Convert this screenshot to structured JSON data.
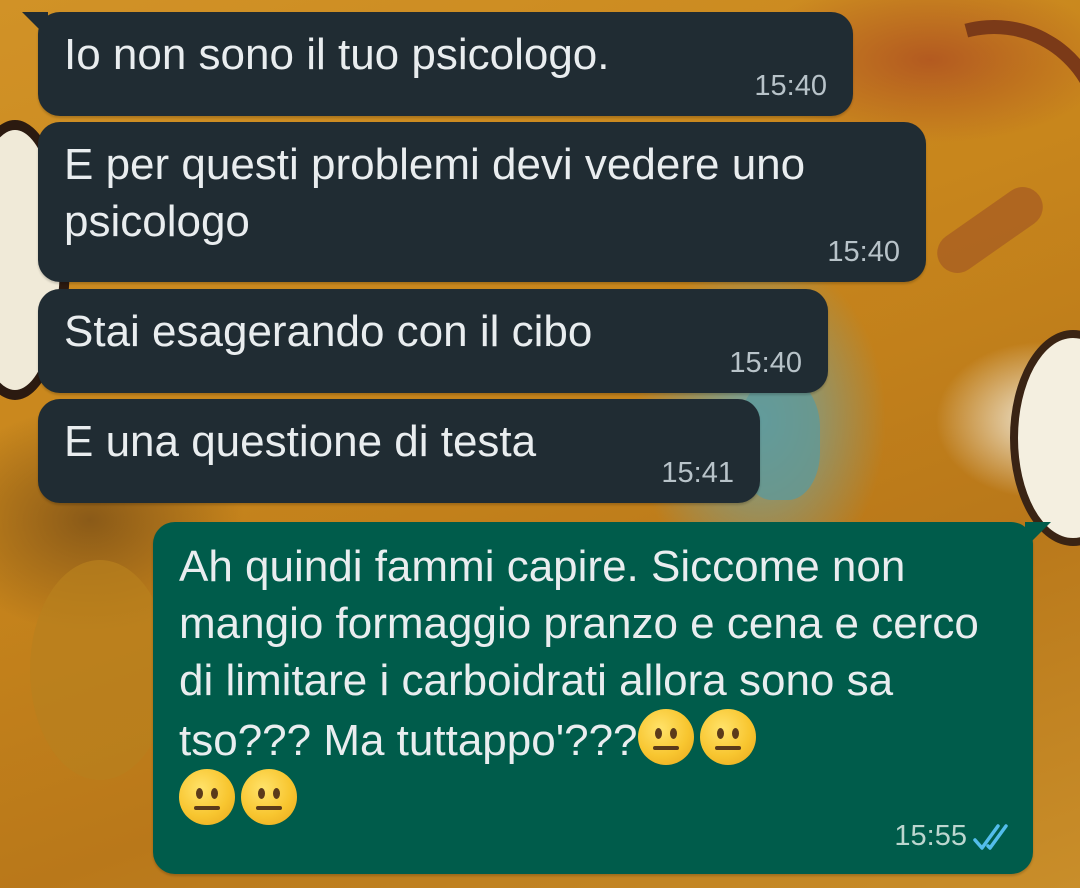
{
  "messages": [
    {
      "direction": "incoming",
      "text": "Io non sono il tuo psicologo.",
      "time": "15:40"
    },
    {
      "direction": "incoming",
      "text": "E per questi problemi devi vedere uno psicologo",
      "time": "15:40"
    },
    {
      "direction": "incoming",
      "text": "Stai esagerando con il cibo",
      "time": "15:40"
    },
    {
      "direction": "incoming",
      "text": "E una questione di testa",
      "time": "15:41"
    },
    {
      "direction": "outgoing",
      "text": "Ah quindi fammi capire. Siccome non mangio formaggio pranzo e cena e cerco di limitare i carboidrati allora sono sa tso??? Ma tuttappo'???",
      "emoji": [
        "neutral-face-emoji",
        "neutral-face-emoji",
        "neutral-face-emoji",
        "neutral-face-emoji"
      ],
      "time": "15:55",
      "status": "read",
      "status_icon": "double-check-icon"
    }
  ],
  "colors": {
    "incoming_bubble": "#202c33",
    "outgoing_bubble": "#005c4b",
    "message_text": "#e9edef",
    "timestamp_text": "#b8c3c9",
    "read_ticks": "#53bdeb"
  }
}
